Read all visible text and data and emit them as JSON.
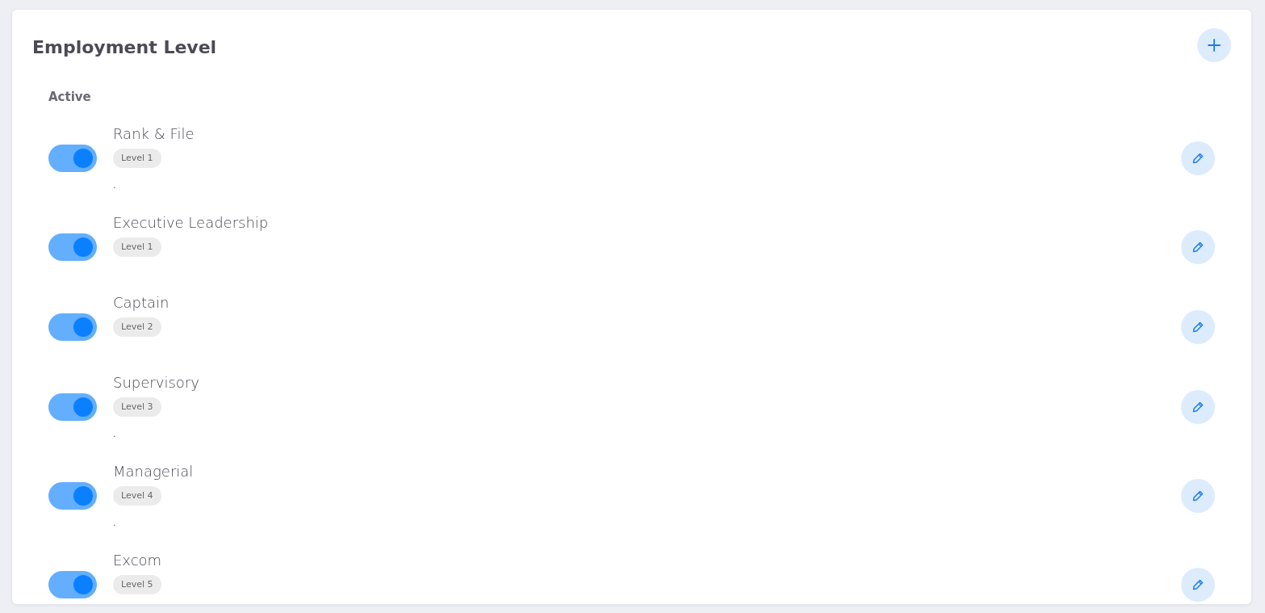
{
  "card": {
    "title": "Employment Level"
  },
  "section": {
    "label": "Active"
  },
  "items": [
    {
      "name": "Rank & File",
      "level": "Level 1",
      "description": ".",
      "on": true
    },
    {
      "name": "Executive Leadership",
      "level": "Level 1",
      "on": true
    },
    {
      "name": "Captain",
      "level": "Level 2",
      "on": true
    },
    {
      "name": "Supervisory",
      "level": "Level 3",
      "description": ".",
      "on": true
    },
    {
      "name": "Managerial",
      "level": "Level 4",
      "description": ".",
      "on": true
    },
    {
      "name": "Excom",
      "level": "Level 5",
      "on": true
    }
  ]
}
